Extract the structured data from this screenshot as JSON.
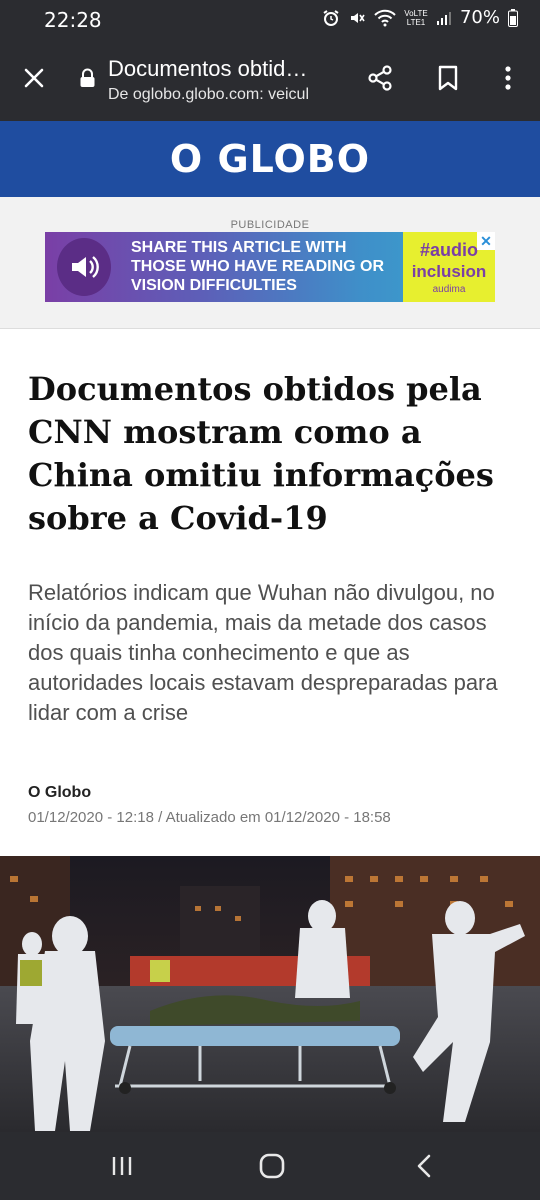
{
  "status_bar": {
    "time": "22:28",
    "network": "VoLTE LTE1",
    "battery": "70%"
  },
  "browser": {
    "title": "Documentos obtid…",
    "url": "De oglobo.globo.com: veicul",
    "icons": [
      "close-icon",
      "lock-icon",
      "share-icon",
      "bookmark-icon",
      "more-vert-icon"
    ]
  },
  "site": {
    "logo": "O GLOBO",
    "brand_color": "#1f4da0"
  },
  "ad": {
    "label": "PUBLICIDADE",
    "text": "SHARE THIS ARTICLE WITH THOSE WHO HAVE READING OR VISION DIFFICULTIES",
    "hashtag": "#audio",
    "inclusion": "inclusion",
    "brand": "audima",
    "close": "✕"
  },
  "article": {
    "headline": "Documentos obtidos pela CNN mostram como a China omitiu informações sobre a Covid-19",
    "subtitle": "Relatórios indicam que Wuhan não divulgou, no início da pandemia, mais da metade dos casos dos quais tinha conhecimento e que as autoridades locais estavam despreparadas para lidar com a crise",
    "author": "O Globo",
    "dates": "01/12/2020 - 12:18 / Atualizado em 01/12/2020 - 18:58"
  },
  "nav": {
    "icons": [
      "recents-icon",
      "home-icon",
      "back-icon"
    ]
  }
}
